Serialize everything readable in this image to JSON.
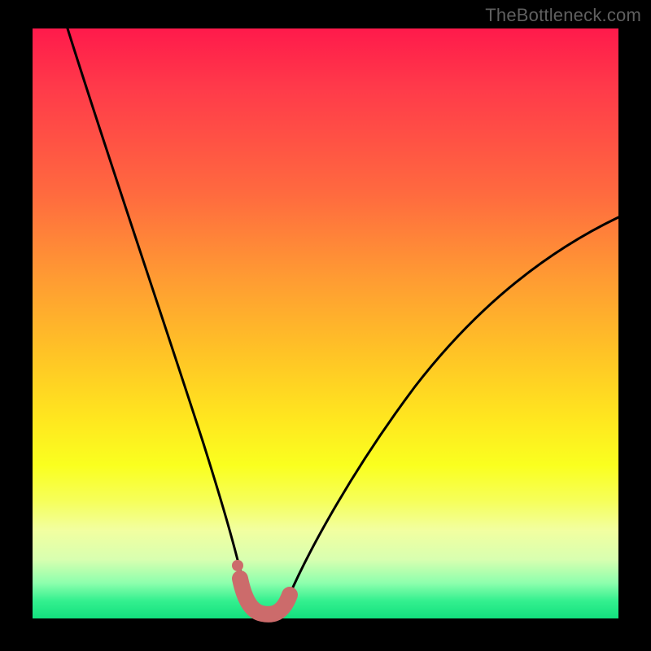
{
  "attribution": "TheBottleneck.com",
  "colors": {
    "frame": "#000000",
    "gradient_top": "#ff1a4b",
    "gradient_mid": "#ffe61f",
    "gradient_bottom": "#13e07e",
    "curve": "#000000",
    "highlight": "#cc6b6b"
  },
  "chart_data": {
    "type": "line",
    "title": "",
    "xlabel": "",
    "ylabel": "",
    "xlim": [
      0,
      100
    ],
    "ylim": [
      0,
      100
    ],
    "note": "Axes are unlabeled; values are normalized 0–100 estimates read from pixel positions. Lower y = bottom of plot.",
    "series": [
      {
        "name": "left-branch",
        "x": [
          6,
          10,
          14,
          18,
          22,
          25,
          28,
          30,
          32,
          34,
          35.5,
          36.5
        ],
        "y": [
          100,
          84,
          69,
          55,
          42,
          32,
          23,
          17,
          11,
          6,
          3,
          1
        ]
      },
      {
        "name": "right-branch",
        "x": [
          43.5,
          45,
          47,
          50,
          54,
          59,
          65,
          72,
          80,
          89,
          100
        ],
        "y": [
          1,
          3,
          7,
          13,
          21,
          30,
          39,
          47,
          54,
          61,
          68
        ]
      },
      {
        "name": "valley-highlight",
        "x": [
          35.5,
          36.5,
          37.5,
          38.5,
          39.5,
          40.5,
          41.5,
          42.5,
          43.5
        ],
        "y": [
          3.0,
          1.0,
          0.3,
          0.1,
          0.1,
          0.1,
          0.3,
          1.0,
          3.0
        ]
      }
    ],
    "markers": [
      {
        "name": "left-dot",
        "x": 35.2,
        "y": 6.0
      }
    ]
  }
}
